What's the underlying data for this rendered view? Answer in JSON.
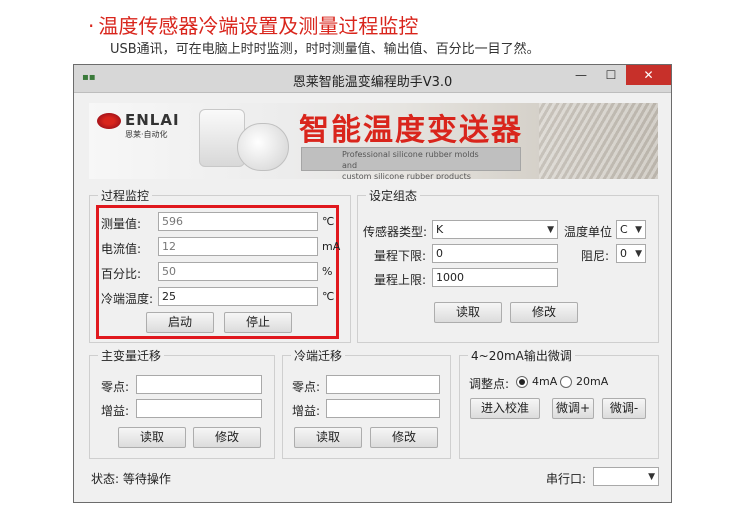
{
  "header": {
    "dot": "·",
    "title": "温度传感器冷端设置及测量过程监控",
    "subtitle": "USB通讯，可在电脑上时时监测，时时测量值、输出值、百分比一目了然。"
  },
  "window": {
    "title": "恩莱智能温变编程助手V3.0",
    "min_glyph": "—",
    "max_glyph": "☐",
    "close_glyph": "✕"
  },
  "banner": {
    "brand": "ENLAI",
    "brand_cn": "恩莱·自动化",
    "title": "智能温度变送器",
    "en_line1": "Professional silicone rubber molds and",
    "en_line2": "custom silicone rubber products manufacturer"
  },
  "process": {
    "label": "过程监控",
    "rows": [
      {
        "label": "测量值:",
        "value": "596",
        "unit": "℃",
        "readonly": true
      },
      {
        "label": "电流值:",
        "value": "12",
        "unit": "mA",
        "readonly": true
      },
      {
        "label": "百分比:",
        "value": "50",
        "unit": "%",
        "readonly": true
      },
      {
        "label": "冷端温度:",
        "value": "25",
        "unit": "℃",
        "readonly": false
      }
    ],
    "start_btn": "启动",
    "stop_btn": "停止"
  },
  "config": {
    "label": "设定组态",
    "sensor_type_label": "传感器类型:",
    "sensor_type_value": "K",
    "temp_unit_label": "温度单位",
    "temp_unit_value": "C",
    "range_low_label": "量程下限:",
    "range_low_value": "0",
    "range_high_label": "量程上限:",
    "range_high_value": "1000",
    "damping_label": "阻尼:",
    "damping_value": "0",
    "read_btn": "读取",
    "modify_btn": "修改"
  },
  "main_var": {
    "label": "主变量迁移",
    "zero_label": "零点:",
    "gain_label": "增益:",
    "read_btn": "读取",
    "modify_btn": "修改"
  },
  "cold_junction": {
    "label": "冷端迁移",
    "zero_label": "零点:",
    "gain_label": "增益:",
    "read_btn": "读取",
    "modify_btn": "修改"
  },
  "fine_tune": {
    "label": "4~20mA输出微调",
    "point_label": "调整点:",
    "opt_4ma": "4mA",
    "opt_20ma": "20mA",
    "calibrate_btn": "进入校准",
    "up_btn": "微调+",
    "down_btn": "微调-"
  },
  "statusbar": {
    "status_text": "状态: 等待操作",
    "serial_label": "串行口:",
    "serial_value": ""
  }
}
